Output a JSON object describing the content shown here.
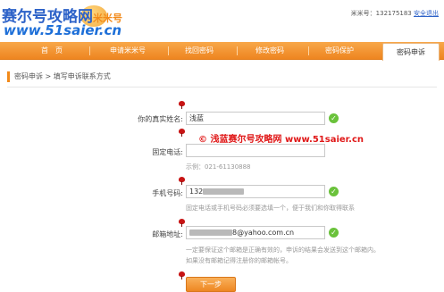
{
  "header": {
    "logo_text": "赛尔号攻略网",
    "logo_sub": "米米号",
    "logo_url": "www.51saier.cn",
    "user_label": "米米号：",
    "user_id": "132175183",
    "safe_exit": "安全退出"
  },
  "nav": {
    "items": [
      {
        "label": "首　页"
      },
      {
        "label": "申请米米号"
      },
      {
        "label": "找回密码"
      },
      {
        "label": "修改密码"
      },
      {
        "label": "密码保护"
      },
      {
        "label": "密码申诉"
      }
    ]
  },
  "breadcrumb": "密码申诉 > 填写申诉联系方式",
  "form": {
    "real_name": {
      "label": "你的真实姓名:",
      "value": "浅蓝"
    },
    "phone": {
      "label": "固定电话:",
      "value": "",
      "hint": "示例：021-61130888"
    },
    "mobile": {
      "label": "手机号码:",
      "value_prefix": "132"
    },
    "mobile_hint": "固定电话或手机号码必须要选填一个，便于我们和你取得联系",
    "email": {
      "label": "邮箱地址:",
      "value_suffix": "8@yahoo.com.cn"
    },
    "email_hint_1": "一定要保证这个邮箱是正确有效的，申诉的结果会发送到这个邮箱内。",
    "email_hint_2": "如果没有邮箱记得注册你的邮箱帐号。",
    "next_button": "下一步"
  },
  "watermark": "© 浅蓝赛尔号攻略网 www.51saier.cn",
  "colors": {
    "accent": "#ee8520",
    "link": "#2d62c8",
    "valid": "#6ac23b",
    "watermark": "#e01818"
  }
}
